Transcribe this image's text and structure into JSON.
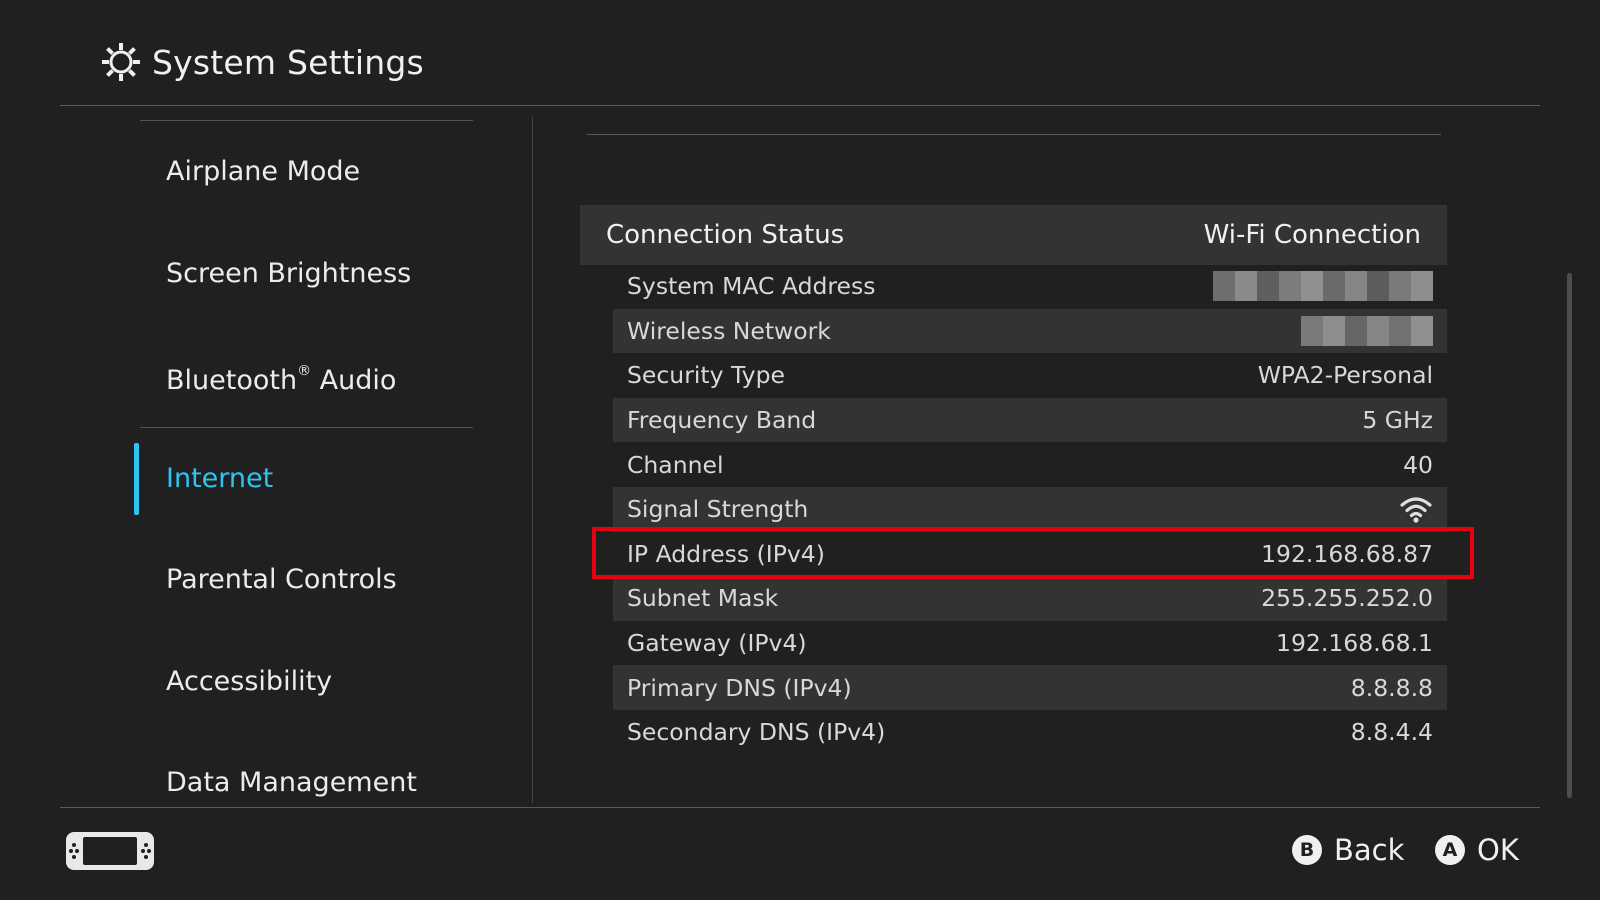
{
  "header": {
    "title": "System Settings",
    "icon": "gear-icon"
  },
  "sidebar": {
    "items": [
      {
        "label": "Airplane Mode"
      },
      {
        "label": "Screen Brightness"
      },
      {
        "label": "Bluetooth",
        "suffix": "Audio",
        "mark": "®"
      },
      {
        "label": "Internet",
        "active": true
      },
      {
        "label": "Parental Controls"
      },
      {
        "label": "Accessibility"
      },
      {
        "label": "Data Management"
      }
    ]
  },
  "connection": {
    "header_label": "Connection Status",
    "header_value": "Wi-Fi Connection",
    "rows": [
      {
        "label": "System MAC Address",
        "value": null,
        "redacted": true
      },
      {
        "label": "Wireless Network",
        "value": null,
        "redacted": true
      },
      {
        "label": "Security Type",
        "value": "WPA2-Personal"
      },
      {
        "label": "Frequency Band",
        "value": "5 GHz"
      },
      {
        "label": "Channel",
        "value": "40"
      },
      {
        "label": "Signal Strength",
        "value": null,
        "icon": "wifi-signal-icon",
        "level": 3,
        "max_level": 3
      },
      {
        "label": "IP Address (IPv4)",
        "value": "192.168.68.87",
        "highlighted": true
      },
      {
        "label": "Subnet Mask",
        "value": "255.255.252.0"
      },
      {
        "label": "Gateway (IPv4)",
        "value": "192.168.68.1"
      },
      {
        "label": "Primary DNS (IPv4)",
        "value": "8.8.8.8"
      },
      {
        "label": "Secondary DNS (IPv4)",
        "value": "8.8.4.4"
      }
    ]
  },
  "footer": {
    "back_glyph": "B",
    "back_label": "Back",
    "ok_glyph": "A",
    "ok_label": "OK",
    "console_icon": "handheld-console-icon"
  },
  "colors": {
    "background": "#202020",
    "accent": "#2fc3f4",
    "highlight": "#e60012",
    "row_shade": "#333333"
  }
}
